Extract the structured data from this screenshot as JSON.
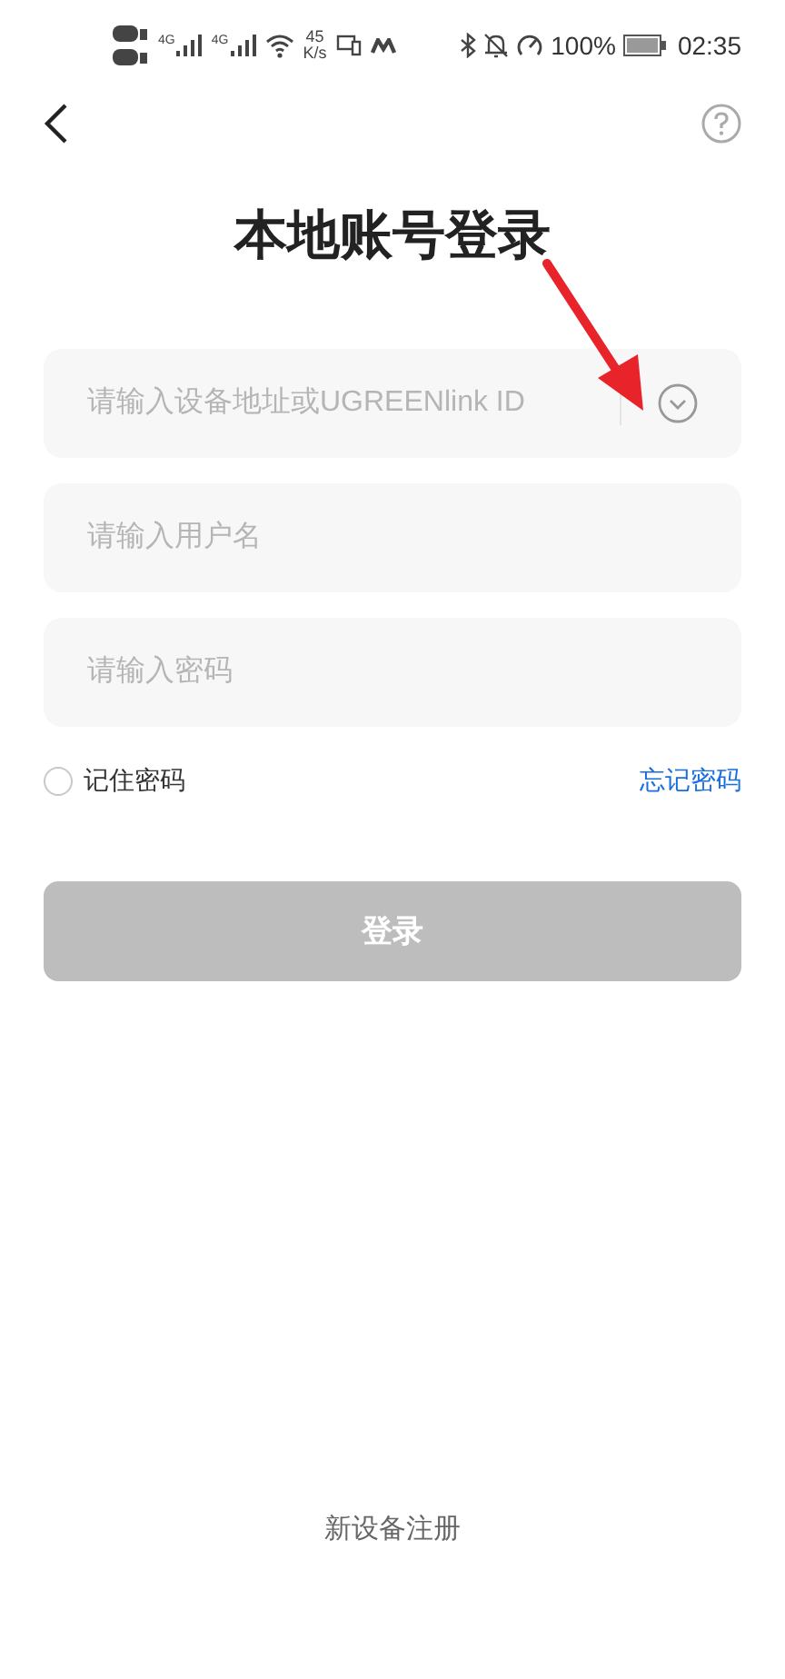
{
  "status_bar": {
    "network_type_1": "4G",
    "network_type_2": "4G",
    "speed_value": "45",
    "speed_unit": "K/s",
    "battery": "100%",
    "time": "02:35"
  },
  "title": "本地账号登录",
  "fields": [
    {
      "kind": "dropdown",
      "placeholder": "请输入设备地址或UGREENlink ID"
    },
    {
      "kind": "text",
      "placeholder": "请输入用户名"
    },
    {
      "kind": "password",
      "placeholder": "请输入密码"
    }
  ],
  "remember_password": {
    "label": "记住密码",
    "checked": false
  },
  "forgot_password": "忘记密码",
  "login_button": {
    "label": "登录",
    "disabled": true
  },
  "register_link": "新设备注册"
}
